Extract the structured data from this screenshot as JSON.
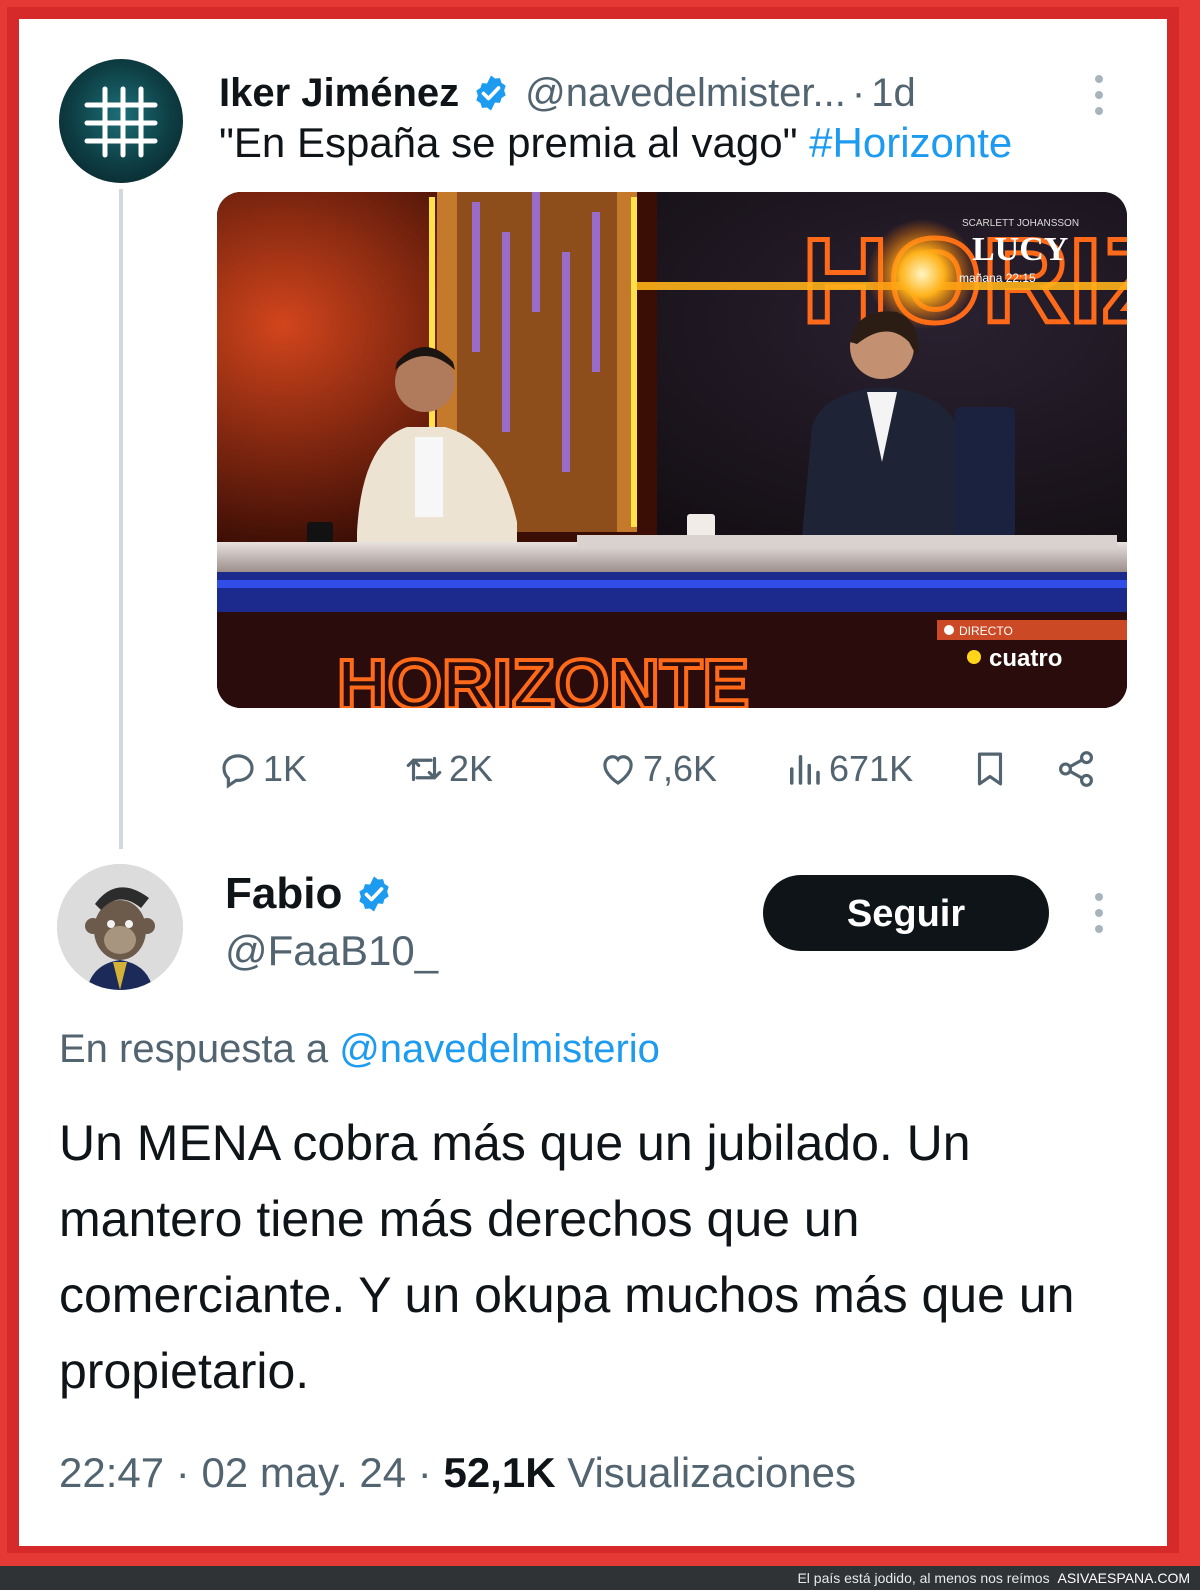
{
  "tweet1": {
    "author_name": "Iker Jiménez",
    "handle": "@navedelmister...",
    "separator": "·",
    "time": "1d",
    "text": "\"En España se premia al vago\"",
    "hashtag": "#Horizonte",
    "media": {
      "top_right_promo_small": "SCARLETT JOHANSSON",
      "top_right_promo_title": "LUCY",
      "top_right_promo_time": "mañana 22:15",
      "show_logo": "HORIZ",
      "bottom_logo": "HORIZONTE",
      "live_label": "DIRECTO",
      "channel": "cuatro"
    },
    "actions": {
      "replies": "1K",
      "reposts": "2K",
      "likes": "7,6K",
      "views": "671K"
    }
  },
  "tweet2": {
    "author_name": "Fabio",
    "handle": "@FaaB10_",
    "follow_label": "Seguir",
    "reply_prefix": "En respuesta a",
    "reply_mention": "@navedelmisterio",
    "text": "Un MENA cobra más que un jubilado. Un mantero tiene más derechos que un comerciante. Y un okupa muchos más que un propietario.",
    "time": "22:47",
    "date": "02 may. 24",
    "separator": "·",
    "views_count": "52,1K",
    "views_label": "Visualizaciones"
  },
  "footer": {
    "caption": "El país está jodido, al menos nos reímos",
    "site": "ASIVAESPANA.COM"
  },
  "colors": {
    "accent": "#1d9bf0",
    "text": "#0f1419",
    "secondary": "#536471",
    "border": "#e53935"
  }
}
